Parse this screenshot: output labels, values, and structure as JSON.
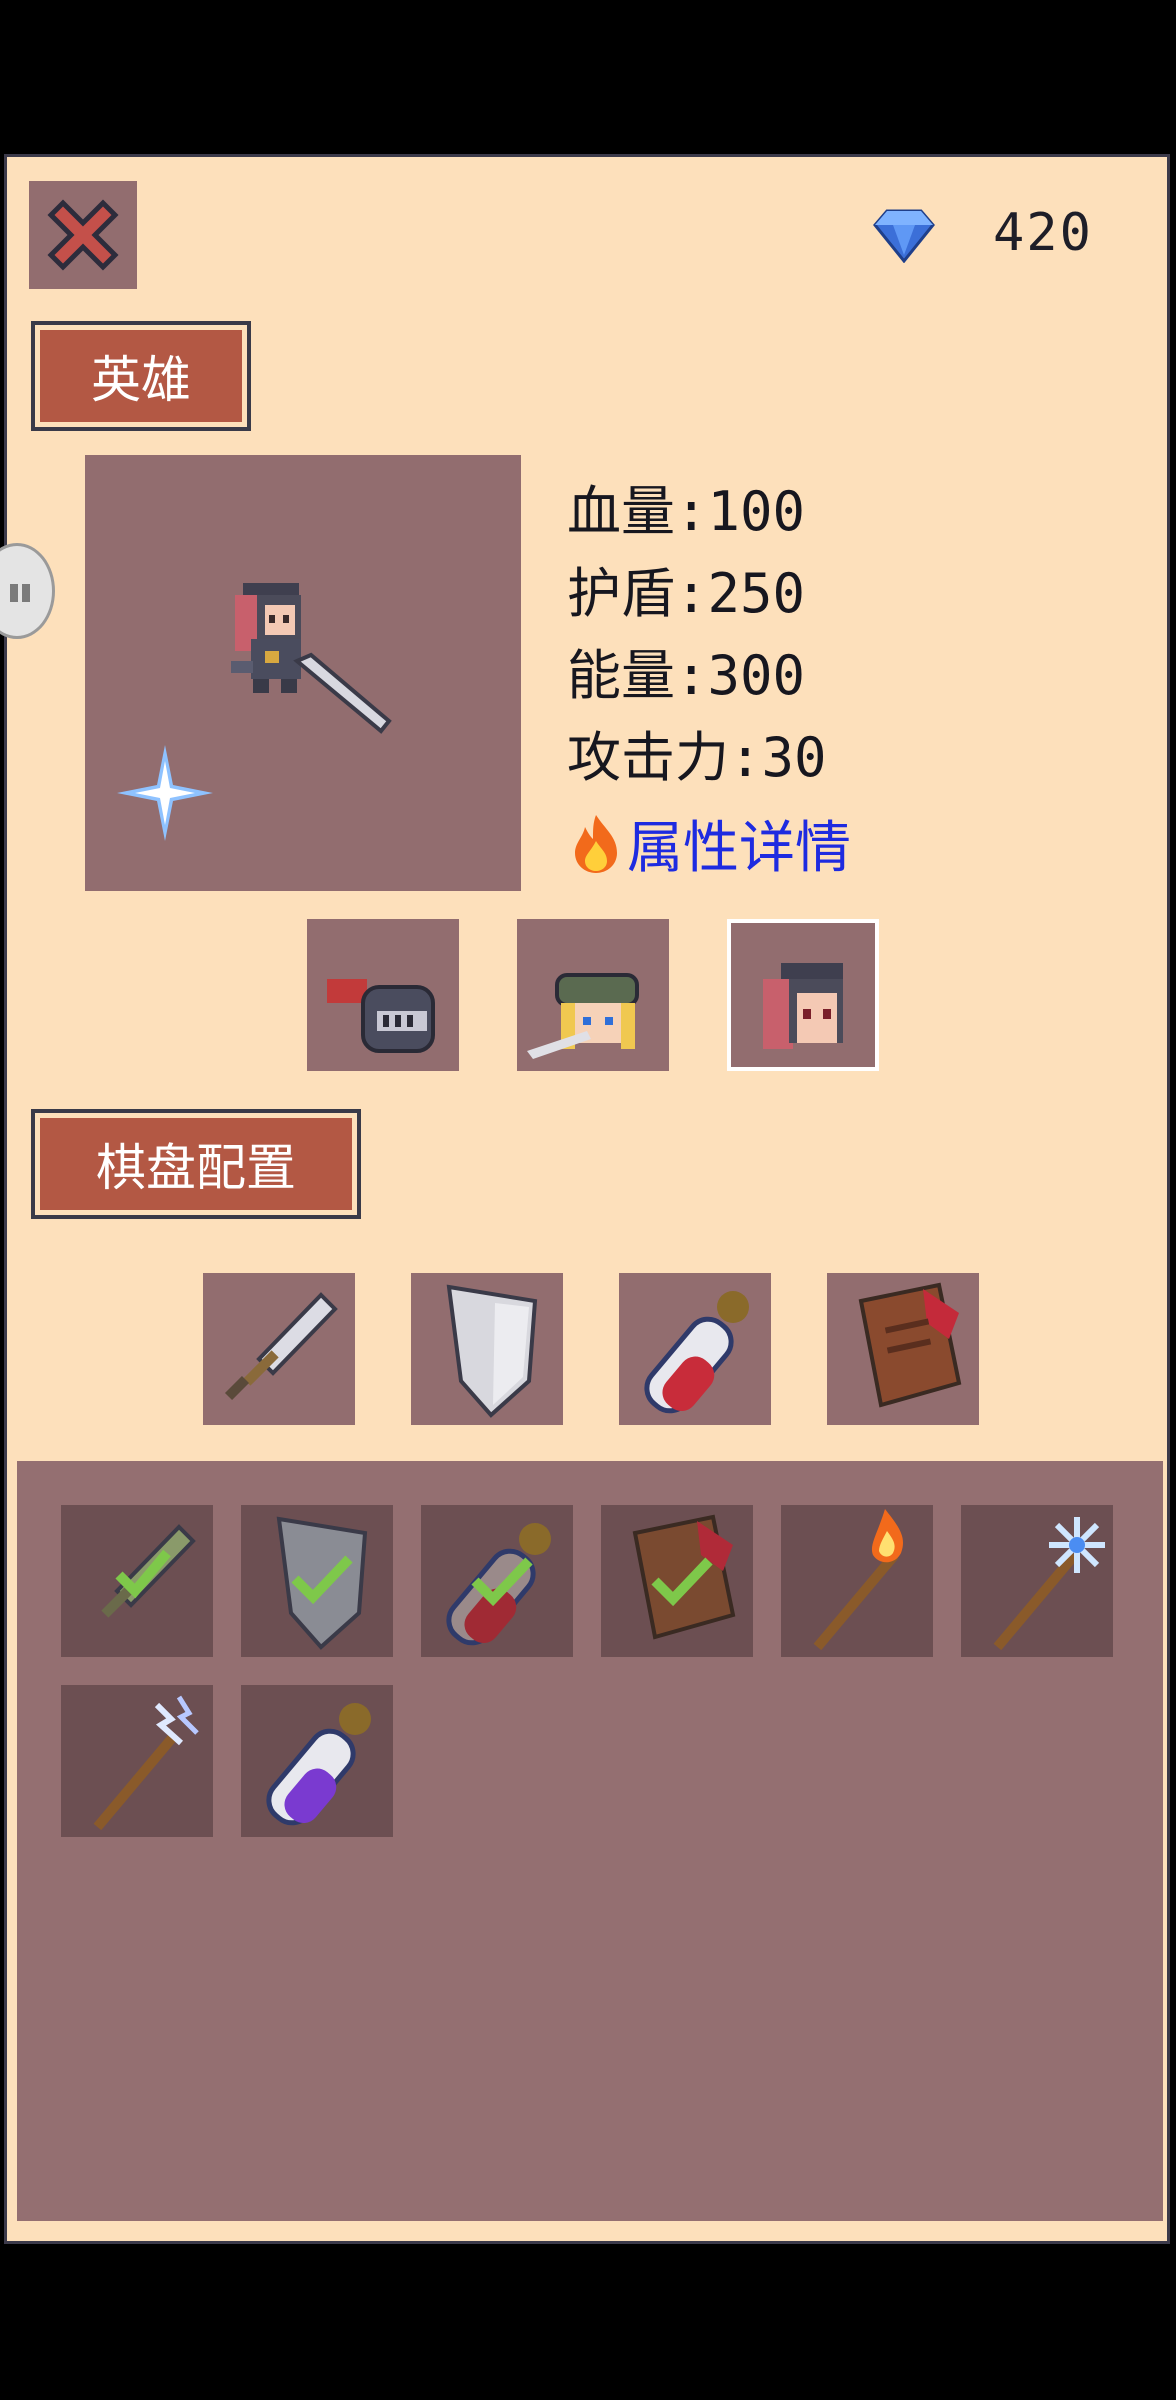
{
  "currency": {
    "value": "420",
    "icon": "diamond-gem-icon",
    "color": "#4b8df2"
  },
  "hero_section": {
    "label": "英雄",
    "stats": {
      "hp": "血量:100",
      "shield": "护盾:250",
      "energy": "能量:300",
      "attack": "攻击力:30"
    },
    "details_link": "属性详情",
    "portraits": [
      {
        "name": "knight",
        "selected": false
      },
      {
        "name": "ranger",
        "selected": false
      },
      {
        "name": "swordswoman",
        "selected": true
      }
    ]
  },
  "board_section": {
    "label": "棋盘配置",
    "equipped": [
      "sword",
      "shield",
      "red-potion",
      "spellbook"
    ]
  },
  "inventory": {
    "items": [
      {
        "name": "sword",
        "checked": true
      },
      {
        "name": "shield",
        "checked": true
      },
      {
        "name": "red-potion",
        "checked": true
      },
      {
        "name": "spellbook",
        "checked": true
      },
      {
        "name": "fire-staff",
        "checked": false
      },
      {
        "name": "ice-staff",
        "checked": false
      },
      {
        "name": "lightning-staff",
        "checked": false
      },
      {
        "name": "purple-potion",
        "checked": false
      }
    ]
  },
  "colors": {
    "panel_bg": "#fde0bb",
    "slot_bg": "#926d6f",
    "label_bg": "#b35844",
    "link": "#1e2be0"
  }
}
